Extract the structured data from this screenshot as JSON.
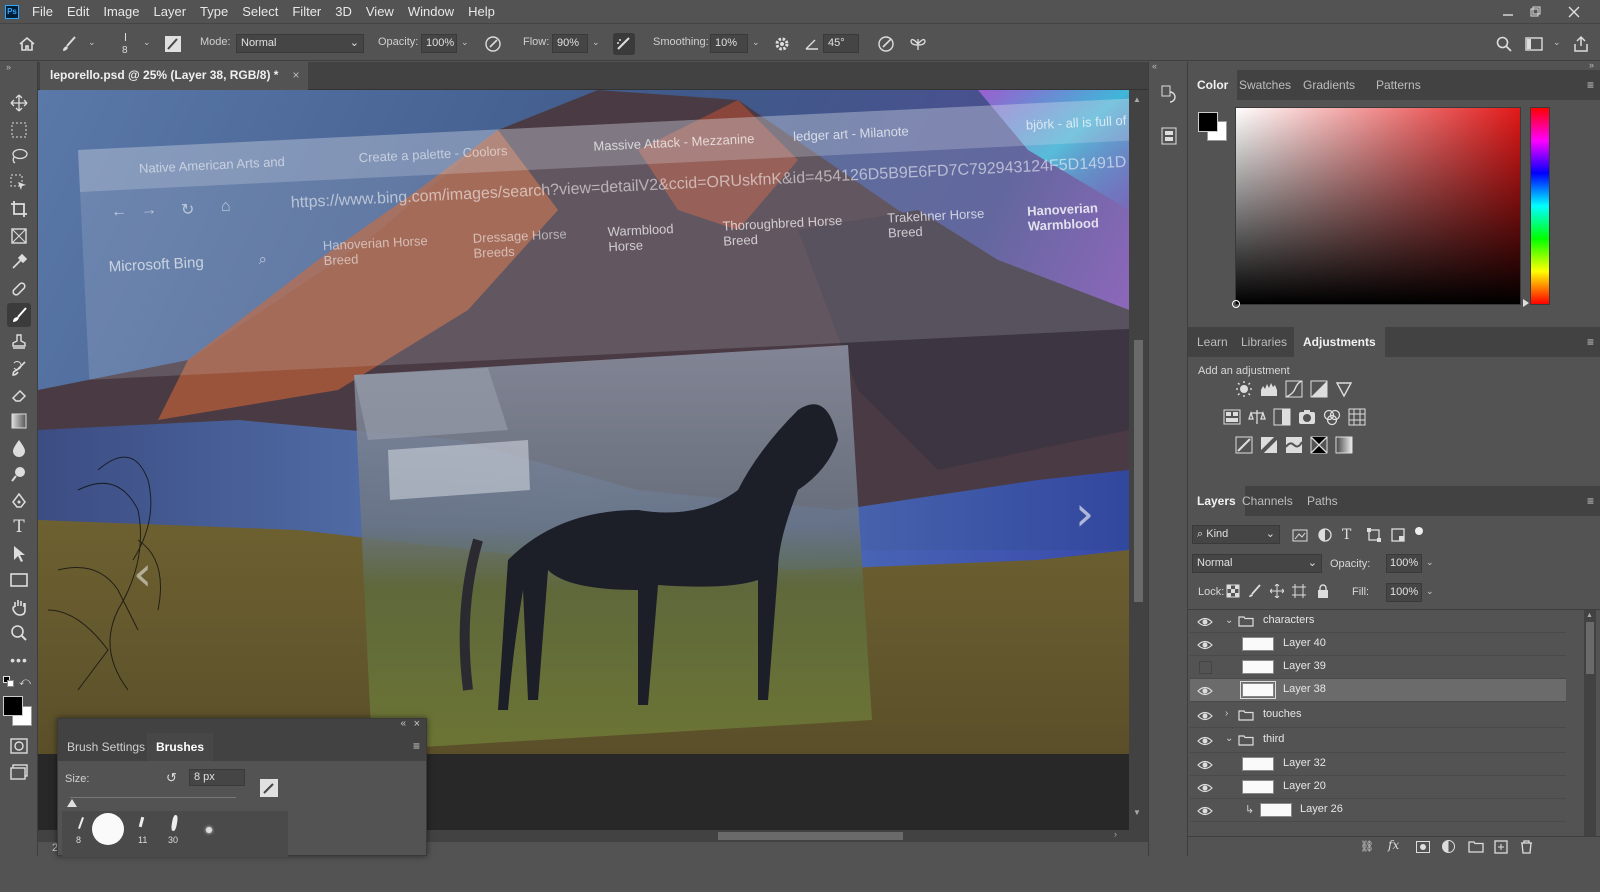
{
  "app": {
    "menu": [
      "File",
      "Edit",
      "Image",
      "Layer",
      "Type",
      "Select",
      "Filter",
      "3D",
      "View",
      "Window",
      "Help"
    ]
  },
  "options": {
    "brush_size": "8",
    "mode_label": "Mode:",
    "mode_value": "Normal",
    "opacity_label": "Opacity:",
    "opacity_value": "100%",
    "flow_label": "Flow:",
    "flow_value": "90%",
    "smoothing_label": "Smoothing:",
    "smoothing_value": "10%",
    "angle_value": "45°"
  },
  "document": {
    "tab_title": "leporello.psd @ 25% (Layer 38, RGB/8) *",
    "zoom_indicator": "2"
  },
  "canvas_overlay": {
    "browser_tabs": [
      "Native American Arts and",
      "Create a palette - Coolors",
      "Massive Attack - Mezzanine",
      "ledger art - Milanote",
      "björk - all is full of"
    ],
    "url": "https://www.bing.com/images/search?view=detailV2&ccid=ORUskfnK&id=454126D5B9E6FD7C792943124F5D1491D",
    "search_brand": "Microsoft Bing",
    "chips": [
      "Hanoverian Horse Breed",
      "Dressage Horse Breeds",
      "Warmblood Horse",
      "Thoroughbred Horse Breed",
      "Trakehner Horse Breed",
      "Hanoverian Warmblood"
    ]
  },
  "brush_panel": {
    "tab_settings": "Brush Settings",
    "tab_brushes": "Brushes",
    "size_label": "Size:",
    "size_value": "8 px",
    "preset_sizes": [
      "8",
      "11",
      "30"
    ]
  },
  "color_panel": {
    "tabs": [
      "Color",
      "Swatches",
      "Gradients",
      "Patterns"
    ],
    "active_tab": "Color",
    "foreground": "#000000",
    "background": "#ffffff",
    "hue_color": "#e21818"
  },
  "adjustments_panel": {
    "tabs": [
      "Learn",
      "Libraries",
      "Adjustments"
    ],
    "active_tab": "Adjustments",
    "add_label": "Add an adjustment"
  },
  "layers_panel": {
    "tabs": [
      "Layers",
      "Channels",
      "Paths"
    ],
    "active_tab": "Layers",
    "filter_kind": "Kind",
    "blend_mode": "Normal",
    "opacity_label": "Opacity:",
    "opacity_value": "100%",
    "lock_label": "Lock:",
    "fill_label": "Fill:",
    "fill_value": "100%",
    "layers": [
      {
        "name": "characters",
        "type": "group",
        "expanded": true,
        "visible": true,
        "indent": 0
      },
      {
        "name": "Layer 40",
        "type": "layer",
        "visible": true,
        "indent": 1
      },
      {
        "name": "Layer 39",
        "type": "layer",
        "visible": false,
        "indent": 1
      },
      {
        "name": "Layer 38",
        "type": "layer",
        "visible": true,
        "indent": 1,
        "selected": true
      },
      {
        "name": "touches",
        "type": "group",
        "expanded": false,
        "visible": true,
        "indent": 0
      },
      {
        "name": "third",
        "type": "group",
        "expanded": true,
        "visible": true,
        "indent": 0
      },
      {
        "name": "Layer 32",
        "type": "layer",
        "visible": true,
        "indent": 1
      },
      {
        "name": "Layer 20",
        "type": "layer",
        "visible": true,
        "indent": 1
      },
      {
        "name": "Layer 26",
        "type": "layer",
        "visible": true,
        "indent": 1,
        "clipped": true
      }
    ]
  }
}
